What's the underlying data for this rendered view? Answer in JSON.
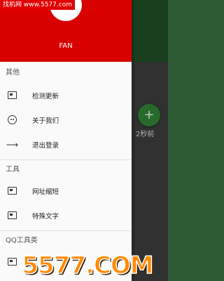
{
  "watermark_top": "找机网 www.5577.com",
  "watermark_bottom": "5577.COM",
  "background_app": {
    "fab_symbol": "+",
    "fab_label": "2秒前"
  },
  "drawer": {
    "user_name": "FAN",
    "sections": [
      {
        "title": "其他",
        "items": [
          {
            "label": "检测更新",
            "icon": "card-icon"
          },
          {
            "label": "关于我们",
            "icon": "face-icon"
          },
          {
            "label": "退出登录",
            "icon": "logout-arrow-icon"
          }
        ]
      },
      {
        "title": "工具",
        "items": [
          {
            "label": "网址缩短",
            "icon": "card-icon"
          },
          {
            "label": "特殊文字",
            "icon": "card-icon"
          }
        ]
      },
      {
        "title": "QQ工具类",
        "items": [
          {
            "label": "",
            "icon": "card-icon"
          }
        ]
      }
    ]
  },
  "colors": {
    "header_red": "#d90000",
    "drawer_bg": "#fafafa",
    "fab_green": "#2e7d32"
  }
}
